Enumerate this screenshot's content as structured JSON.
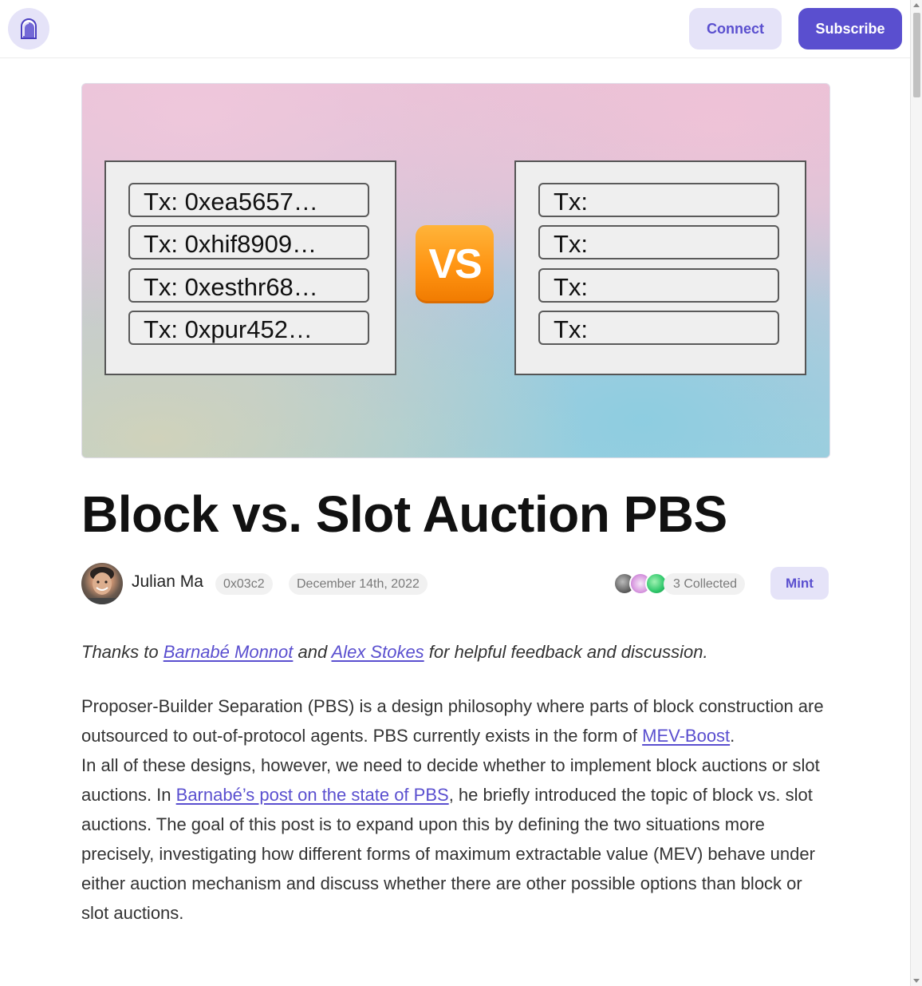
{
  "header": {
    "connect_label": "Connect",
    "subscribe_label": "Subscribe"
  },
  "hero": {
    "left_txs": [
      "Tx: 0xea5657…",
      "Tx: 0xhif8909…",
      "Tx: 0xesthr68…",
      "Tx: 0xpur452…"
    ],
    "right_txs": [
      "Tx:",
      "Tx:",
      "Tx:",
      "Tx:"
    ],
    "vs_label": "VS"
  },
  "post": {
    "title": "Block vs. Slot Auction PBS",
    "author": "Julian Ma",
    "author_address": "0x03c2",
    "date": "December 14th, 2022",
    "collected": "3 Collected",
    "mint_label": "Mint"
  },
  "body": {
    "thanks": {
      "prefix": "Thanks to ",
      "link1": "Barnabé Monnot",
      "middle": " and ",
      "link2": "Alex Stokes",
      "suffix": " for helpful feedback and discussion."
    },
    "p1": {
      "text": "Proposer-Builder Separation (PBS) is a design philosophy where parts of block construction are outsourced to out-of-protocol agents. PBS currently exists in the form of ",
      "link": "MEV-Boost",
      "suffix": "."
    },
    "p2": {
      "text": "In all of these designs, however, we need to decide whether to implement block auctions or slot auctions. In ",
      "link": "Barnabé’s post on the state of PBS",
      "suffix": ", he briefly introduced the topic of block vs. slot auctions. The goal of this post is to expand upon this by defining the two situations more precisely, investigating how different forms of maximum extractable value (MEV) behave under either auction mechanism and discuss whether there are other possible options than block or slot auctions."
    }
  },
  "colors": {
    "accent": "#5a4fcf",
    "accent_light": "#e5e3f8",
    "vs_orange": "#ff9412"
  }
}
